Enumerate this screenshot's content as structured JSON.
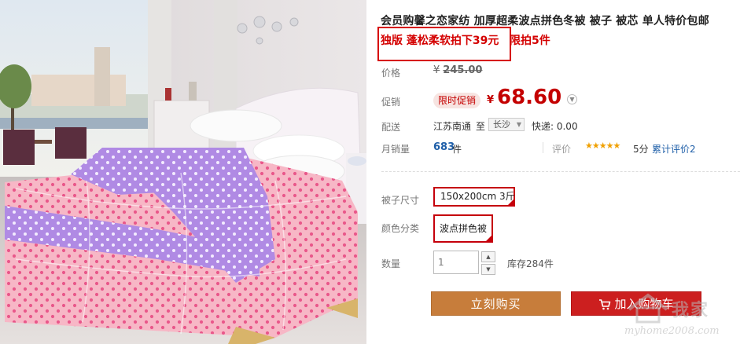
{
  "product": {
    "title": "会员购馨之恋家纺 加厚超柔波点拼色冬被 被子 被芯 单人特价包邮",
    "promo_text": "独版 蓬松柔软拍下39元",
    "promo_limit": "限拍5件"
  },
  "price": {
    "label": "价格",
    "currency": "¥",
    "original": "245.00"
  },
  "promotion": {
    "label": "促销",
    "badge": "限时促销",
    "currency": "¥",
    "sale_price": "68.60",
    "expand_icon": "chevron-down-icon"
  },
  "shipping": {
    "label": "配送",
    "from": "江苏南通",
    "to_word": "至",
    "to_city": "长沙",
    "express": "快递: 0.00"
  },
  "sales": {
    "label": "月销量",
    "count": "683",
    "unit": "件",
    "rating_label": "评价",
    "stars": "★★★★★",
    "score": "5分",
    "reviews_link": "累计评价2"
  },
  "options": {
    "size_label": "被子尺寸",
    "size_value": "150x200cm 3斤",
    "color_label": "颜色分类",
    "color_value": "波点拼色被"
  },
  "quantity": {
    "label": "数量",
    "value": "1",
    "stock": "库存284件"
  },
  "actions": {
    "buy_now": "立刻购买",
    "add_to_cart": "加入购物车"
  },
  "watermark": {
    "brand": "我家",
    "url": "myhome2008.com"
  },
  "colors": {
    "price_red": "#c40000",
    "promo_red": "#d40000",
    "buy_orange": "#c77d3b",
    "cart_red": "#cc1f1f",
    "link_blue": "#1f5fa8"
  }
}
